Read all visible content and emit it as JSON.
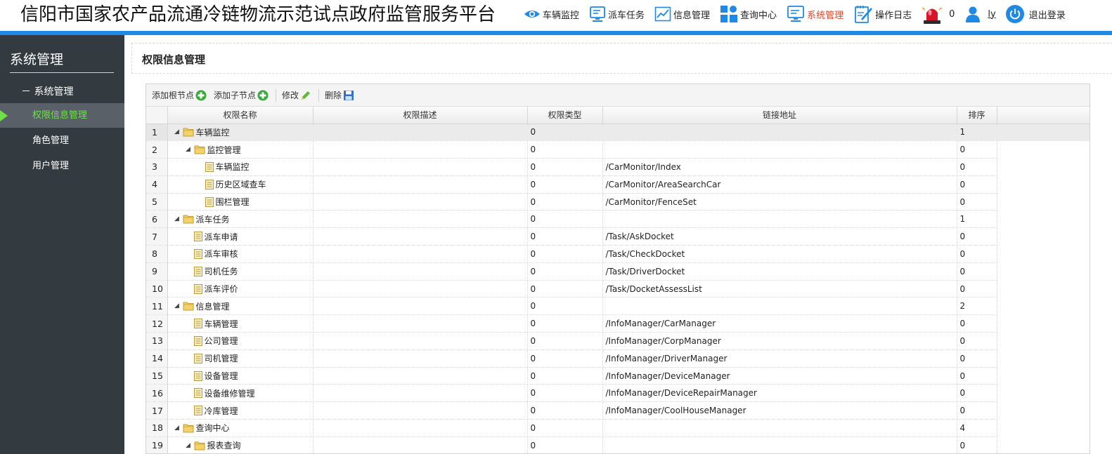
{
  "app": {
    "title": "信阳市国家农产品流通冷链物流示范试点政府监管服务平台"
  },
  "nav": {
    "items": [
      {
        "label": "车辆监控",
        "icon": "eye-icon"
      },
      {
        "label": "派车任务",
        "icon": "monitor-icon"
      },
      {
        "label": "信息管理",
        "icon": "line-chart-icon"
      },
      {
        "label": "查询中心",
        "icon": "grid-icon"
      },
      {
        "label": "系统管理",
        "icon": "monitor-settings-icon",
        "active": true
      },
      {
        "label": "操作日志",
        "icon": "notepad-icon"
      }
    ],
    "alarm_count": "0",
    "user": "ly",
    "logout": "退出登录",
    "active_color": "#e8452e"
  },
  "sidebar": {
    "title": "系统管理",
    "group": "－ 系统管理",
    "items": [
      "权限信息管理",
      "角色管理",
      "用户管理"
    ],
    "active_color": "#6fe04a"
  },
  "panel": {
    "title": "权限信息管理"
  },
  "toolbar": {
    "add_root": "添加根节点",
    "add_child": "添加子节点",
    "edit": "修改",
    "delete": "删除"
  },
  "table": {
    "headers": {
      "name": "权限名称",
      "desc": "权限描述",
      "type": "权限类型",
      "url": "链接地址",
      "sort": "排序"
    },
    "rows": [
      {
        "n": "1",
        "level": 0,
        "folder": true,
        "name": "车辆监控",
        "desc": "",
        "type": "0",
        "url": "",
        "sort": "1"
      },
      {
        "n": "2",
        "level": 1,
        "folder": true,
        "name": "监控管理",
        "desc": "",
        "type": "0",
        "url": "",
        "sort": "0"
      },
      {
        "n": "3",
        "level": 2,
        "folder": false,
        "name": "车辆监控",
        "desc": "",
        "type": "0",
        "url": "/CarMonitor/Index",
        "sort": "0"
      },
      {
        "n": "4",
        "level": 2,
        "folder": false,
        "name": "历史区域查车",
        "desc": "",
        "type": "0",
        "url": "/CarMonitor/AreaSearchCar",
        "sort": "0"
      },
      {
        "n": "5",
        "level": 2,
        "folder": false,
        "name": "围栏管理",
        "desc": "",
        "type": "0",
        "url": "/CarMonitor/FenceSet",
        "sort": "0"
      },
      {
        "n": "6",
        "level": 0,
        "folder": true,
        "name": "派车任务",
        "desc": "",
        "type": "0",
        "url": "",
        "sort": "1"
      },
      {
        "n": "7",
        "level": 1,
        "folder": false,
        "name": "派车申请",
        "desc": "",
        "type": "0",
        "url": "/Task/AskDocket",
        "sort": "0"
      },
      {
        "n": "8",
        "level": 1,
        "folder": false,
        "name": "派车审核",
        "desc": "",
        "type": "0",
        "url": "/Task/CheckDocket",
        "sort": "0"
      },
      {
        "n": "9",
        "level": 1,
        "folder": false,
        "name": "司机任务",
        "desc": "",
        "type": "0",
        "url": "/Task/DriverDocket",
        "sort": "0"
      },
      {
        "n": "10",
        "level": 1,
        "folder": false,
        "name": "派车评价",
        "desc": "",
        "type": "0",
        "url": "/Task/DocketAssessList",
        "sort": "0"
      },
      {
        "n": "11",
        "level": 0,
        "folder": true,
        "name": "信息管理",
        "desc": "",
        "type": "0",
        "url": "",
        "sort": "2"
      },
      {
        "n": "12",
        "level": 1,
        "folder": false,
        "name": "车辆管理",
        "desc": "",
        "type": "0",
        "url": "/InfoManager/CarManager",
        "sort": "0"
      },
      {
        "n": "13",
        "level": 1,
        "folder": false,
        "name": "公司管理",
        "desc": "",
        "type": "0",
        "url": "/InfoManager/CorpManager",
        "sort": "0"
      },
      {
        "n": "14",
        "level": 1,
        "folder": false,
        "name": "司机管理",
        "desc": "",
        "type": "0",
        "url": "/InfoManager/DriverManager",
        "sort": "0"
      },
      {
        "n": "15",
        "level": 1,
        "folder": false,
        "name": "设备管理",
        "desc": "",
        "type": "0",
        "url": "/InfoManager/DeviceManager",
        "sort": "0"
      },
      {
        "n": "16",
        "level": 1,
        "folder": false,
        "name": "设备维修管理",
        "desc": "",
        "type": "0",
        "url": "/InfoManager/DeviceRepairManager",
        "sort": "0"
      },
      {
        "n": "17",
        "level": 1,
        "folder": false,
        "name": "冷库管理",
        "desc": "",
        "type": "0",
        "url": "/InfoManager/CoolHouseManager",
        "sort": "0"
      },
      {
        "n": "18",
        "level": 0,
        "folder": true,
        "name": "查询中心",
        "desc": "",
        "type": "0",
        "url": "",
        "sort": "4"
      },
      {
        "n": "19",
        "level": 1,
        "folder": true,
        "name": "报表查询",
        "desc": "",
        "type": "0",
        "url": "",
        "sort": "0"
      }
    ]
  }
}
